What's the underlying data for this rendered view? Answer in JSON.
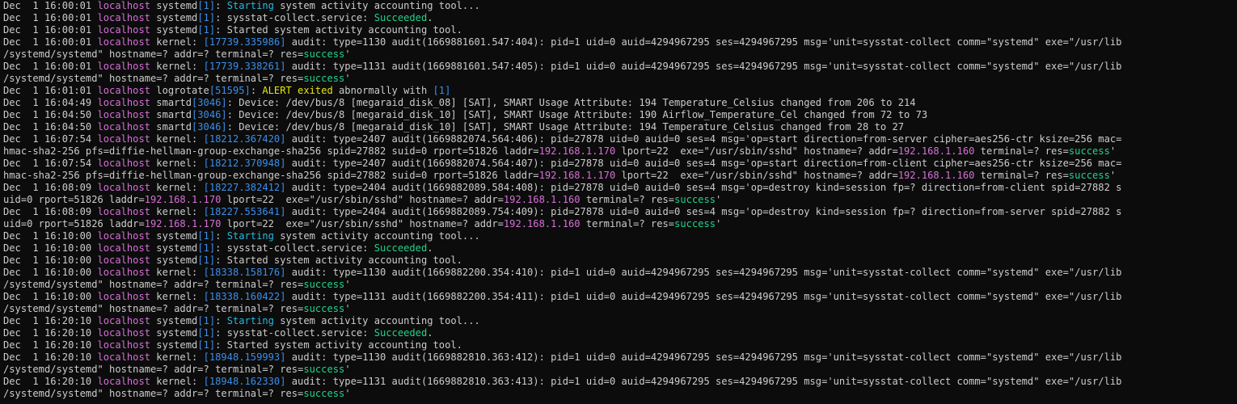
{
  "terminal": {
    "lines": [
      [
        [
          "Dec  1 16:00:01 ",
          "plain"
        ],
        [
          "localhost",
          "host"
        ],
        [
          " systemd",
          "plain"
        ],
        [
          "[1]",
          "pid"
        ],
        [
          ": ",
          "plain"
        ],
        [
          "Starting",
          "starting"
        ],
        [
          " system activity accounting tool...",
          "plain"
        ]
      ],
      [
        [
          "Dec  1 16:00:01 ",
          "plain"
        ],
        [
          "localhost",
          "host"
        ],
        [
          " systemd",
          "plain"
        ],
        [
          "[1]",
          "pid"
        ],
        [
          ": sysstat-collect.service: ",
          "plain"
        ],
        [
          "Succeeded",
          "success"
        ],
        [
          ".",
          "plain"
        ]
      ],
      [
        [
          "Dec  1 16:00:01 ",
          "plain"
        ],
        [
          "localhost",
          "host"
        ],
        [
          " systemd",
          "plain"
        ],
        [
          "[1]",
          "pid"
        ],
        [
          ": Started system activity accounting tool.",
          "plain"
        ]
      ],
      [
        [
          "Dec  1 16:00:01 ",
          "plain"
        ],
        [
          "localhost",
          "host"
        ],
        [
          " kernel: ",
          "plain"
        ],
        [
          "[17739.335986]",
          "pid"
        ],
        [
          " audit: type=1130 audit(1669881601.547:404): pid=1 uid=0 auid=4294967295 ses=4294967295 msg='unit=sysstat-collect comm=\"systemd\" exe=\"/usr/lib",
          "plain"
        ]
      ],
      [
        [
          "/systemd/systemd\" hostname=? addr=? terminal=? res=",
          "plain"
        ],
        [
          "success",
          "success"
        ],
        [
          "'",
          "plain"
        ]
      ],
      [
        [
          "Dec  1 16:00:01 ",
          "plain"
        ],
        [
          "localhost",
          "host"
        ],
        [
          " kernel: ",
          "plain"
        ],
        [
          "[17739.338261]",
          "pid"
        ],
        [
          " audit: type=1131 audit(1669881601.547:405): pid=1 uid=0 auid=4294967295 ses=4294967295 msg='unit=sysstat-collect comm=\"systemd\" exe=\"/usr/lib",
          "plain"
        ]
      ],
      [
        [
          "/systemd/systemd\" hostname=? addr=? terminal=? res=",
          "plain"
        ],
        [
          "success",
          "success"
        ],
        [
          "'",
          "plain"
        ]
      ],
      [
        [
          "Dec  1 16:01:01 ",
          "plain"
        ],
        [
          "localhost",
          "host"
        ],
        [
          " logrotate",
          "plain"
        ],
        [
          "[51595]",
          "pid"
        ],
        [
          ": ",
          "plain"
        ],
        [
          "ALERT exited",
          "alert"
        ],
        [
          " abnormally with ",
          "plain"
        ],
        [
          "[1]",
          "pid"
        ]
      ],
      [
        [
          "Dec  1 16:04:49 ",
          "plain"
        ],
        [
          "localhost",
          "host"
        ],
        [
          " smartd",
          "plain"
        ],
        [
          "[3046]",
          "pid"
        ],
        [
          ": Device: /dev/bus/8 [megaraid_disk_08] [SAT], SMART Usage Attribute: 194 Temperature_Celsius changed from 206 to 214",
          "plain"
        ]
      ],
      [
        [
          "Dec  1 16:04:50 ",
          "plain"
        ],
        [
          "localhost",
          "host"
        ],
        [
          " smartd",
          "plain"
        ],
        [
          "[3046]",
          "pid"
        ],
        [
          ": Device: /dev/bus/8 [megaraid_disk_10] [SAT], SMART Usage Attribute: 190 Airflow_Temperature_Cel changed from 72 to 73",
          "plain"
        ]
      ],
      [
        [
          "Dec  1 16:04:50 ",
          "plain"
        ],
        [
          "localhost",
          "host"
        ],
        [
          " smartd",
          "plain"
        ],
        [
          "[3046]",
          "pid"
        ],
        [
          ": Device: /dev/bus/8 [megaraid_disk_10] [SAT], SMART Usage Attribute: 194 Temperature_Celsius changed from 28 to 27",
          "plain"
        ]
      ],
      [
        [
          "Dec  1 16:07:54 ",
          "plain"
        ],
        [
          "localhost",
          "host"
        ],
        [
          " kernel: ",
          "plain"
        ],
        [
          "[18212.367420]",
          "pid"
        ],
        [
          " audit: type=2407 audit(1669882074.564:406): pid=27878 uid=0 auid=0 ses=4 msg='op=start direction=from-server cipher=aes256-ctr ksize=256 mac=",
          "plain"
        ]
      ],
      [
        [
          "hmac-sha2-256 pfs=diffie-hellman-group-exchange-sha256 spid=27882 suid=0 rport=51826 laddr=",
          "plain"
        ],
        [
          "192.168.1.170",
          "ip"
        ],
        [
          " lport=22  exe=\"/usr/sbin/sshd\" hostname=? addr=",
          "plain"
        ],
        [
          "192.168.1.160",
          "ip"
        ],
        [
          " terminal=? res=",
          "plain"
        ],
        [
          "success",
          "success"
        ],
        [
          "'",
          "plain"
        ]
      ],
      [
        [
          "Dec  1 16:07:54 ",
          "plain"
        ],
        [
          "localhost",
          "host"
        ],
        [
          " kernel: ",
          "plain"
        ],
        [
          "[18212.370948]",
          "pid"
        ],
        [
          " audit: type=2407 audit(1669882074.564:407): pid=27878 uid=0 auid=0 ses=4 msg='op=start direction=from-client cipher=aes256-ctr ksize=256 mac=",
          "plain"
        ]
      ],
      [
        [
          "hmac-sha2-256 pfs=diffie-hellman-group-exchange-sha256 spid=27882 suid=0 rport=51826 laddr=",
          "plain"
        ],
        [
          "192.168.1.170",
          "ip"
        ],
        [
          " lport=22  exe=\"/usr/sbin/sshd\" hostname=? addr=",
          "plain"
        ],
        [
          "192.168.1.160",
          "ip"
        ],
        [
          " terminal=? res=",
          "plain"
        ],
        [
          "success",
          "success"
        ],
        [
          "'",
          "plain"
        ]
      ],
      [
        [
          "Dec  1 16:08:09 ",
          "plain"
        ],
        [
          "localhost",
          "host"
        ],
        [
          " kernel: ",
          "plain"
        ],
        [
          "[18227.382412]",
          "pid"
        ],
        [
          " audit: type=2404 audit(1669882089.584:408): pid=27878 uid=0 auid=0 ses=4 msg='op=destroy kind=session fp=? direction=from-client spid=27882 s",
          "plain"
        ]
      ],
      [
        [
          "uid=0 rport=51826 laddr=",
          "plain"
        ],
        [
          "192.168.1.170",
          "ip"
        ],
        [
          " lport=22  exe=\"/usr/sbin/sshd\" hostname=? addr=",
          "plain"
        ],
        [
          "192.168.1.160",
          "ip"
        ],
        [
          " terminal=? res=",
          "plain"
        ],
        [
          "success",
          "success"
        ],
        [
          "'",
          "plain"
        ]
      ],
      [
        [
          "Dec  1 16:08:09 ",
          "plain"
        ],
        [
          "localhost",
          "host"
        ],
        [
          " kernel: ",
          "plain"
        ],
        [
          "[18227.553641]",
          "pid"
        ],
        [
          " audit: type=2404 audit(1669882089.754:409): pid=27878 uid=0 auid=0 ses=4 msg='op=destroy kind=session fp=? direction=from-server spid=27882 s",
          "plain"
        ]
      ],
      [
        [
          "uid=0 rport=51826 laddr=",
          "plain"
        ],
        [
          "192.168.1.170",
          "ip"
        ],
        [
          " lport=22  exe=\"/usr/sbin/sshd\" hostname=? addr=",
          "plain"
        ],
        [
          "192.168.1.160",
          "ip"
        ],
        [
          " terminal=? res=",
          "plain"
        ],
        [
          "success",
          "success"
        ],
        [
          "'",
          "plain"
        ]
      ],
      [
        [
          "Dec  1 16:10:00 ",
          "plain"
        ],
        [
          "localhost",
          "host"
        ],
        [
          " systemd",
          "plain"
        ],
        [
          "[1]",
          "pid"
        ],
        [
          ": ",
          "plain"
        ],
        [
          "Starting",
          "starting"
        ],
        [
          " system activity accounting tool...",
          "plain"
        ]
      ],
      [
        [
          "Dec  1 16:10:00 ",
          "plain"
        ],
        [
          "localhost",
          "host"
        ],
        [
          " systemd",
          "plain"
        ],
        [
          "[1]",
          "pid"
        ],
        [
          ": sysstat-collect.service: ",
          "plain"
        ],
        [
          "Succeeded",
          "success"
        ],
        [
          ".",
          "plain"
        ]
      ],
      [
        [
          "Dec  1 16:10:00 ",
          "plain"
        ],
        [
          "localhost",
          "host"
        ],
        [
          " systemd",
          "plain"
        ],
        [
          "[1]",
          "pid"
        ],
        [
          ": Started system activity accounting tool.",
          "plain"
        ]
      ],
      [
        [
          "Dec  1 16:10:00 ",
          "plain"
        ],
        [
          "localhost",
          "host"
        ],
        [
          " kernel: ",
          "plain"
        ],
        [
          "[18338.158176]",
          "pid"
        ],
        [
          " audit: type=1130 audit(1669882200.354:410): pid=1 uid=0 auid=4294967295 ses=4294967295 msg='unit=sysstat-collect comm=\"systemd\" exe=\"/usr/lib",
          "plain"
        ]
      ],
      [
        [
          "/systemd/systemd\" hostname=? addr=? terminal=? res=",
          "plain"
        ],
        [
          "success",
          "success"
        ],
        [
          "'",
          "plain"
        ]
      ],
      [
        [
          "Dec  1 16:10:00 ",
          "plain"
        ],
        [
          "localhost",
          "host"
        ],
        [
          " kernel: ",
          "plain"
        ],
        [
          "[18338.160422]",
          "pid"
        ],
        [
          " audit: type=1131 audit(1669882200.354:411): pid=1 uid=0 auid=4294967295 ses=4294967295 msg='unit=sysstat-collect comm=\"systemd\" exe=\"/usr/lib",
          "plain"
        ]
      ],
      [
        [
          "/systemd/systemd\" hostname=? addr=? terminal=? res=",
          "plain"
        ],
        [
          "success",
          "success"
        ],
        [
          "'",
          "plain"
        ]
      ],
      [
        [
          "Dec  1 16:20:10 ",
          "plain"
        ],
        [
          "localhost",
          "host"
        ],
        [
          " systemd",
          "plain"
        ],
        [
          "[1]",
          "pid"
        ],
        [
          ": ",
          "plain"
        ],
        [
          "Starting",
          "starting"
        ],
        [
          " system activity accounting tool...",
          "plain"
        ]
      ],
      [
        [
          "Dec  1 16:20:10 ",
          "plain"
        ],
        [
          "localhost",
          "host"
        ],
        [
          " systemd",
          "plain"
        ],
        [
          "[1]",
          "pid"
        ],
        [
          ": sysstat-collect.service: ",
          "plain"
        ],
        [
          "Succeeded",
          "success"
        ],
        [
          ".",
          "plain"
        ]
      ],
      [
        [
          "Dec  1 16:20:10 ",
          "plain"
        ],
        [
          "localhost",
          "host"
        ],
        [
          " systemd",
          "plain"
        ],
        [
          "[1]",
          "pid"
        ],
        [
          ": Started system activity accounting tool.",
          "plain"
        ]
      ],
      [
        [
          "Dec  1 16:20:10 ",
          "plain"
        ],
        [
          "localhost",
          "host"
        ],
        [
          " kernel: ",
          "plain"
        ],
        [
          "[18948.159993]",
          "pid"
        ],
        [
          " audit: type=1130 audit(1669882810.363:412): pid=1 uid=0 auid=4294967295 ses=4294967295 msg='unit=sysstat-collect comm=\"systemd\" exe=\"/usr/lib",
          "plain"
        ]
      ],
      [
        [
          "/systemd/systemd\" hostname=? addr=? terminal=? res=",
          "plain"
        ],
        [
          "success",
          "success"
        ],
        [
          "'",
          "plain"
        ]
      ],
      [
        [
          "Dec  1 16:20:10 ",
          "plain"
        ],
        [
          "localhost",
          "host"
        ],
        [
          " kernel: ",
          "plain"
        ],
        [
          "[18948.162330]",
          "pid"
        ],
        [
          " audit: type=1131 audit(1669882810.363:413): pid=1 uid=0 auid=4294967295 ses=4294967295 msg='unit=sysstat-collect comm=\"systemd\" exe=\"/usr/lib",
          "plain"
        ]
      ],
      [
        [
          "/systemd/systemd\" hostname=? addr=? terminal=? res=",
          "plain"
        ],
        [
          "success",
          "success"
        ],
        [
          "'",
          "plain"
        ]
      ]
    ],
    "colors": {
      "background": "#0c0c0c",
      "text": "#cccccc",
      "hostname": "#d670d6",
      "pid_bracket": "#3b8eea",
      "starting": "#29b8db",
      "success": "#23d18b",
      "ip_address": "#d670d6",
      "alert": "#e5e510"
    }
  }
}
